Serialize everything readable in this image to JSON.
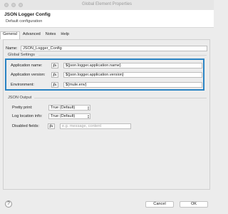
{
  "window": {
    "title": "Global Element Properties"
  },
  "header": {
    "title": "JSON Logger Config",
    "subtitle": "Default configuration"
  },
  "tabs": [
    {
      "label": "General",
      "active": true
    },
    {
      "label": "Advanced",
      "active": false
    },
    {
      "label": "Notes",
      "active": false
    },
    {
      "label": "Help",
      "active": false
    }
  ],
  "name": {
    "label": "Name:",
    "value": "JSON_Logger_Config"
  },
  "global_settings": {
    "section_label": "Global Settings",
    "fields": [
      {
        "label": "Application name:",
        "fx": "fx",
        "value": "${json.logger.application.name}"
      },
      {
        "label": "Application version:",
        "fx": "fx",
        "value": "${json.logger.application.version}"
      },
      {
        "label": "Environment:",
        "fx": "fx",
        "value": "${mule.env}"
      }
    ]
  },
  "json_output": {
    "section_label": "JSON Output",
    "pretty_print": {
      "label": "Pretty print:",
      "value": "True (Default)"
    },
    "log_location": {
      "label": "Log location info:",
      "value": "True (Default)"
    },
    "disabled_fields": {
      "label": "Disabled fields:",
      "fx": "fx",
      "placeholder": "e.g. message, content"
    }
  },
  "footer": {
    "help": "?",
    "cancel": "Cancel",
    "ok": "OK"
  },
  "colors": {
    "highlight": "#2a83c3"
  }
}
